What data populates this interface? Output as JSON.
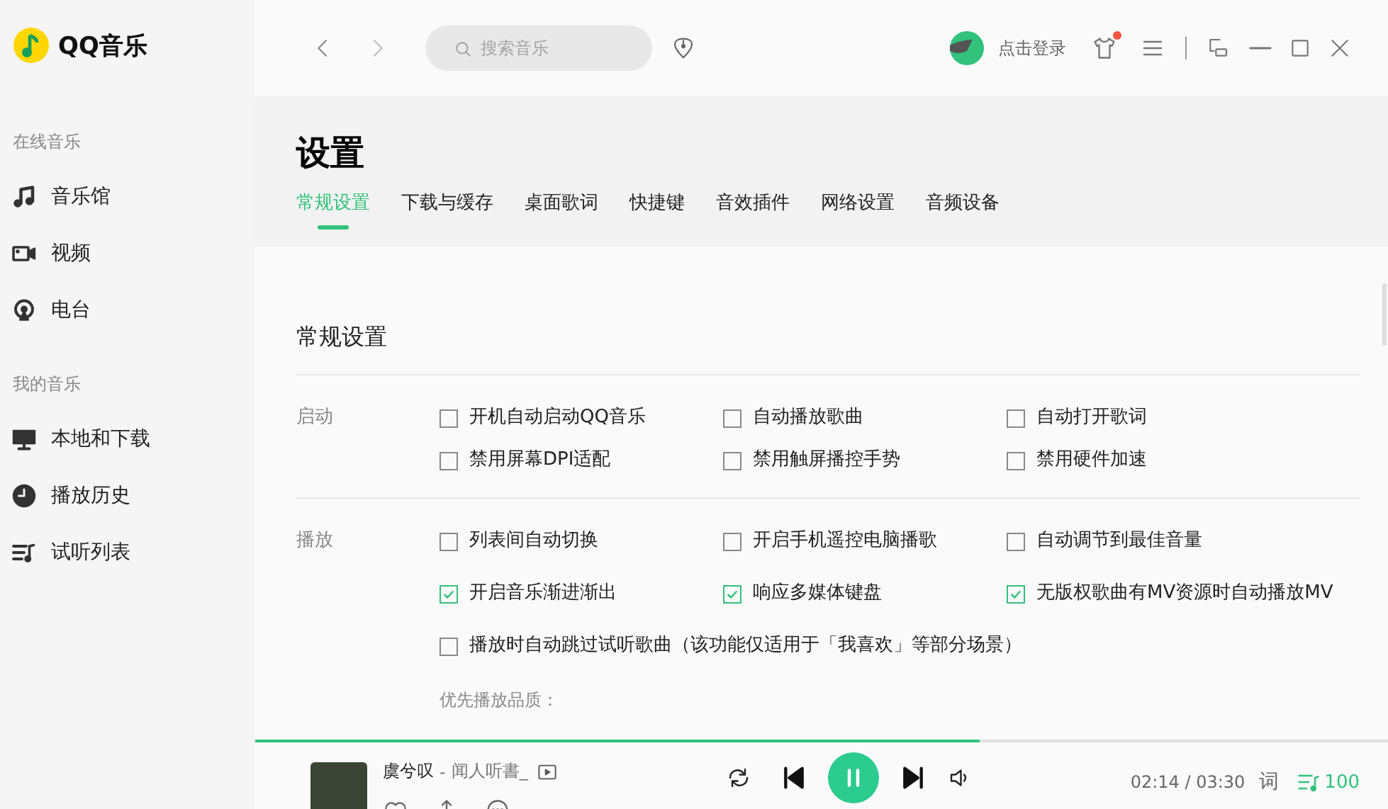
{
  "app": {
    "name": "QQ音乐"
  },
  "sidebar": {
    "groups": [
      {
        "title": "在线音乐",
        "items": [
          {
            "label": "音乐馆",
            "selected": false
          },
          {
            "label": "视频",
            "selected": false
          },
          {
            "label": "电台",
            "selected": false
          }
        ]
      },
      {
        "title": "我的音乐",
        "items": [
          {
            "label": "本地和下载",
            "selected": false
          },
          {
            "label": "播放历史",
            "selected": false
          },
          {
            "label": "试听列表",
            "selected": false
          }
        ]
      }
    ]
  },
  "topbar": {
    "search": {
      "placeholder": "搜索音乐"
    },
    "login": "点击登录",
    "skin_notification": true
  },
  "page": {
    "title": "设置",
    "tabs": [
      {
        "label": "常规设置",
        "selected": true
      },
      {
        "label": "下载与缓存",
        "selected": false
      },
      {
        "label": "桌面歌词",
        "selected": false
      },
      {
        "label": "快捷键",
        "selected": false
      },
      {
        "label": "音效插件",
        "selected": false
      },
      {
        "label": "网络设置",
        "selected": false
      },
      {
        "label": "音频设备",
        "selected": false
      }
    ]
  },
  "settings": {
    "heading": "常规设置",
    "sections": [
      {
        "label": "启动",
        "options": [
          {
            "label": "开机自动启动QQ音乐",
            "checked": false
          },
          {
            "label": "自动播放歌曲",
            "checked": false
          },
          {
            "label": "自动打开歌词",
            "checked": false
          },
          {
            "label": "禁用屏幕DPI适配",
            "checked": false
          },
          {
            "label": "禁用触屏播控手势",
            "checked": false
          },
          {
            "label": "禁用硬件加速",
            "checked": false
          }
        ]
      },
      {
        "label": "播放",
        "options": [
          {
            "label": "列表间自动切换",
            "checked": false
          },
          {
            "label": "开启手机遥控电脑播歌",
            "checked": false
          },
          {
            "label": "自动调节到最佳音量",
            "checked": false
          },
          {
            "label": "开启音乐渐进渐出",
            "checked": true
          },
          {
            "label": "响应多媒体键盘",
            "checked": true
          },
          {
            "label": "无版权歌曲有MV资源时自动播放MV",
            "checked": true
          },
          {
            "label": "播放时自动跳过试听歌曲（该功能仅适用于「我喜欢」等部分场景）",
            "checked": false,
            "wide": true
          }
        ],
        "subheading": "优先播放品质："
      }
    ]
  },
  "player": {
    "progress": {
      "level": 0.64
    },
    "song": "虞兮叹",
    "separator": "-",
    "artist": "闻人听書_",
    "playing": true,
    "time": "02:14 / 03:30",
    "lyrics": "词",
    "playlist_count": "100"
  }
}
